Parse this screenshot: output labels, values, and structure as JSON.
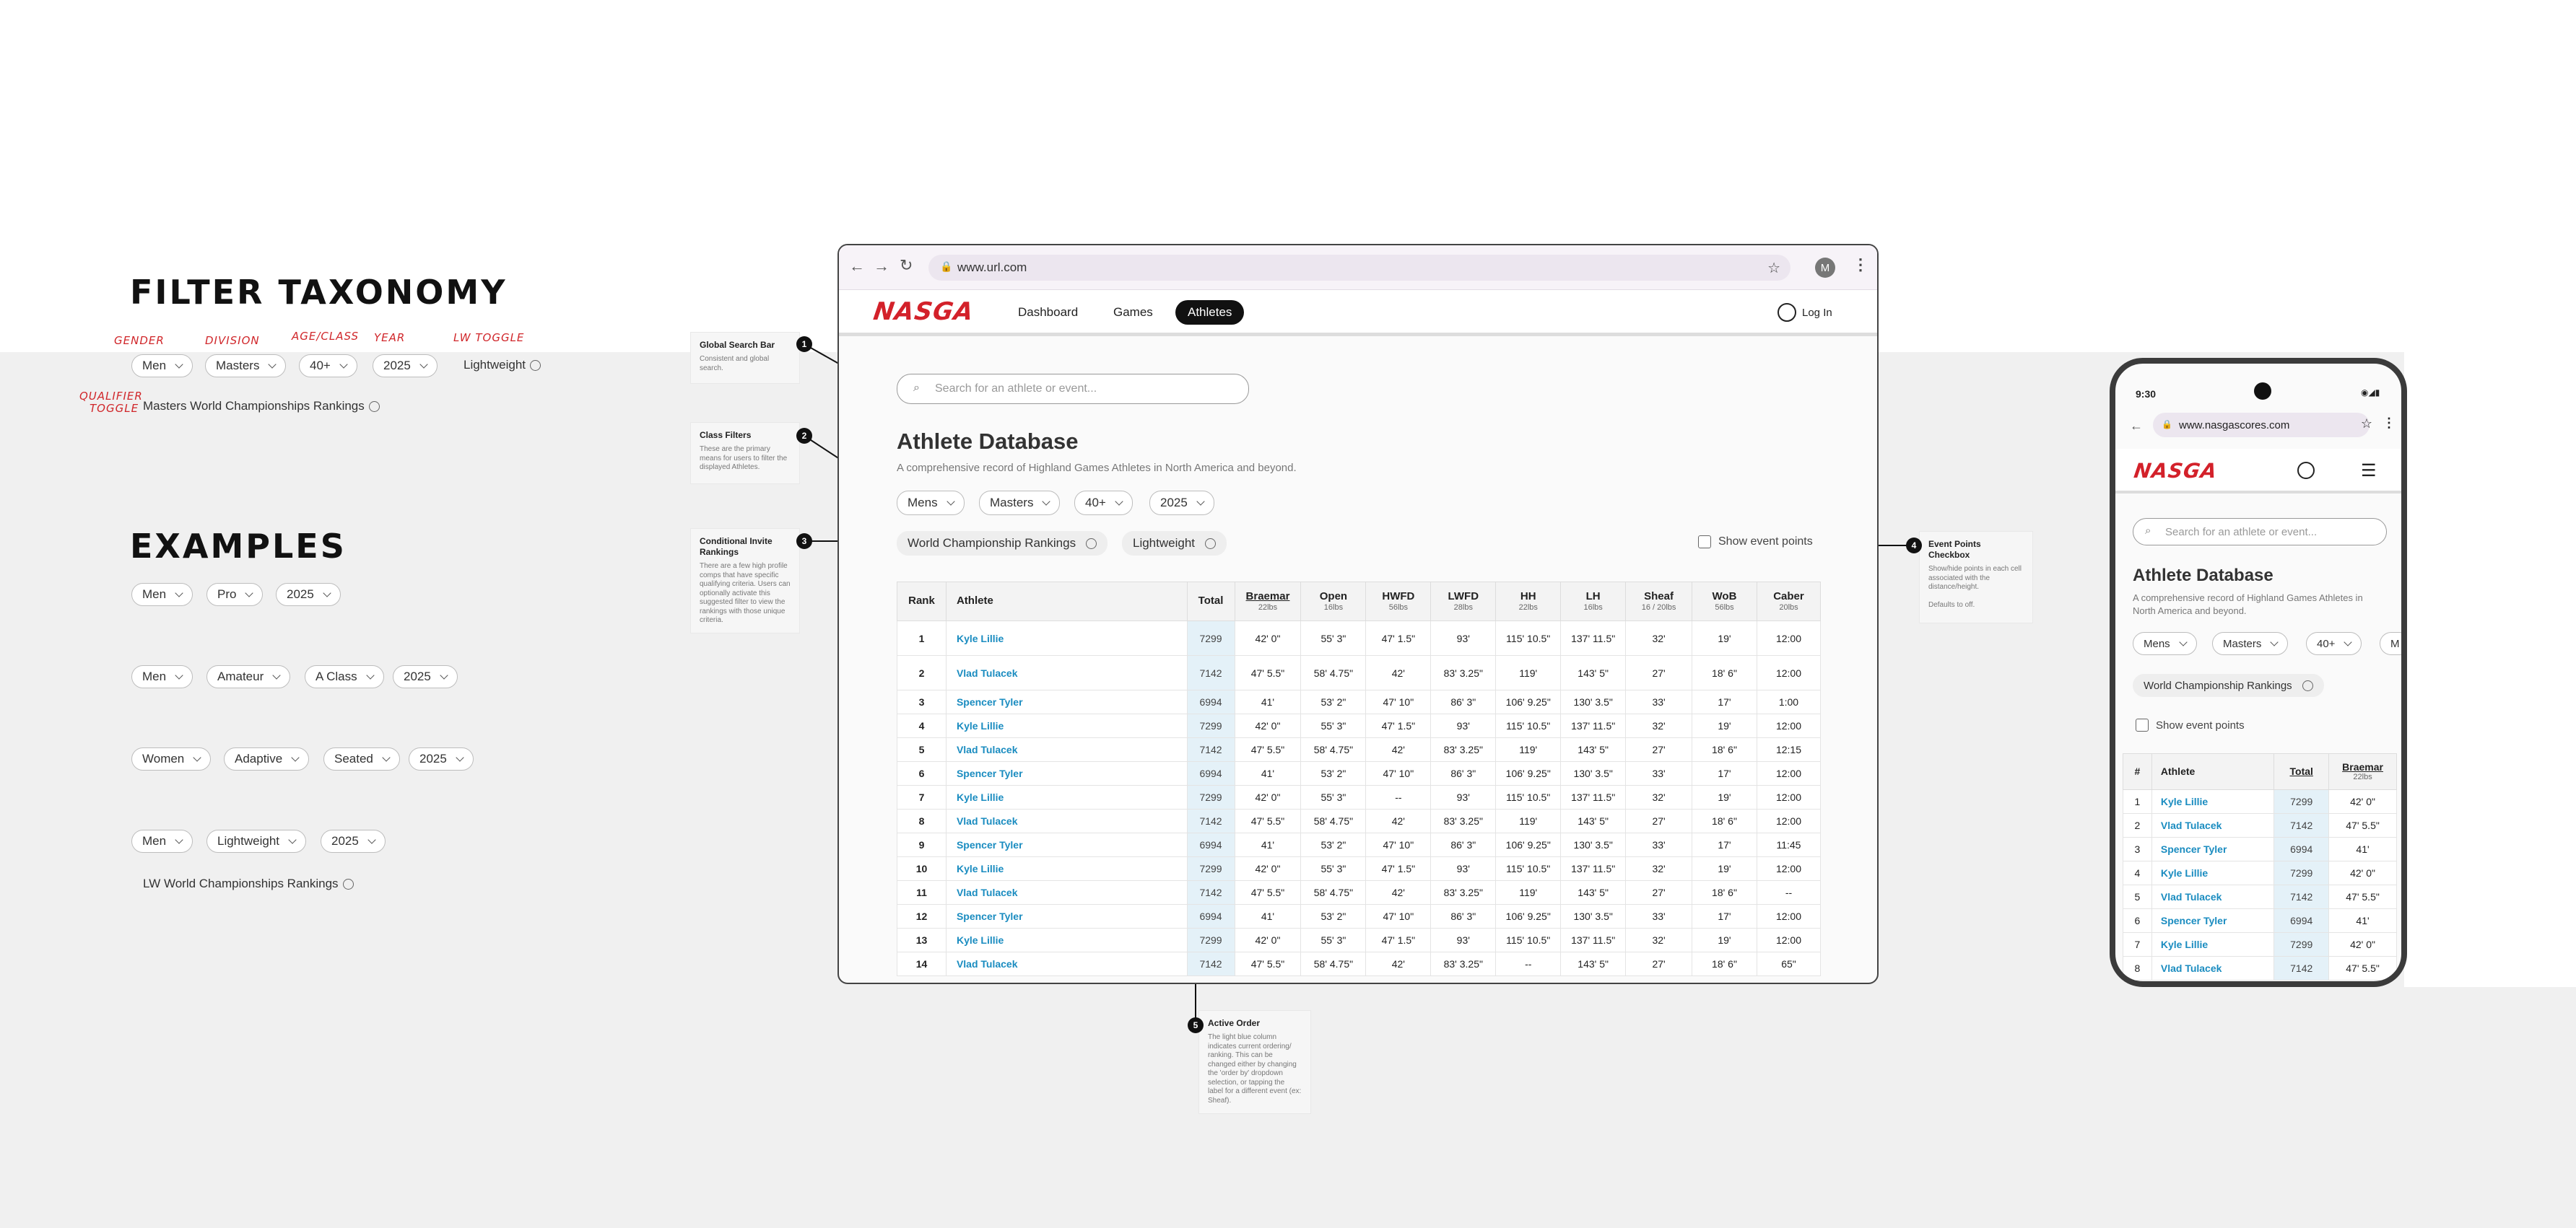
{
  "taxonomy": {
    "title": "FILTER TAXONOMY",
    "hand": {
      "gender": "GENDER",
      "division": "DIVISION",
      "age": "AGE/CLASS",
      "year": "YEAR",
      "lw": "LW TOGGLE",
      "qual1": "QUALIFIER",
      "qual2": "TOGGLE"
    },
    "pills": [
      "Men",
      "Masters",
      "40+",
      "2025"
    ],
    "lw_toggle": "Lightweight",
    "qualifier": "Masters World Championships Rankings"
  },
  "examples": {
    "title": "EXAMPLES",
    "rows": [
      [
        "Men",
        "Pro",
        "2025"
      ],
      [
        "Men",
        "Amateur",
        "A Class",
        "2025"
      ],
      [
        "Women",
        "Adaptive",
        "Seated",
        "2025"
      ],
      [
        "Men",
        "Lightweight",
        "2025"
      ]
    ],
    "lw_rank": "LW World Championships Rankings"
  },
  "notes": {
    "n1": {
      "num": "1",
      "title": "Global Search Bar",
      "body": "Consistent and global search."
    },
    "n2": {
      "num": "2",
      "title": "Class Filters",
      "body": "These are the primary means for users to filter the displayed Athletes."
    },
    "n3": {
      "num": "3",
      "title": "Conditional Invite Rankings",
      "body": "There are a few high profile comps that have specific qualifying criteria. Users can optionally activate this suggested filter to view the rankings with those unique criteria."
    },
    "n4": {
      "num": "4",
      "title": "Event Points Checkbox",
      "body": "Show/hide points in each cell associated with the distance/height.",
      "foot": "Defaults to off."
    },
    "n5": {
      "num": "5",
      "title": "Active Order",
      "body": "The light blue column indicates current ordering/ ranking. This can be changed either by changing the 'order by' dropdown selection, or tapping the label for a different event (ex: Sheaf)."
    }
  },
  "browser": {
    "url": "www.url.com",
    "avatar": "M",
    "logo": "NASGA",
    "nav": [
      "Dashboard",
      "Games",
      "Athletes"
    ],
    "login": "Log In",
    "search_placeholder": "Search for an athlete or event...",
    "title": "Athlete Database",
    "subtitle": "A comprehensive record of Highland Games Athletes in North America and beyond.",
    "filters": [
      "Mens",
      "Masters",
      "40+",
      "2025"
    ],
    "toggle1": "World Championship Rankings",
    "toggle2": "Lightweight",
    "show_points": "Show event points",
    "headers": [
      {
        "t": "Rank",
        "s": ""
      },
      {
        "t": "Athlete",
        "s": ""
      },
      {
        "t": "Total",
        "s": ""
      },
      {
        "t": "Braemar",
        "s": "22lbs"
      },
      {
        "t": "Open",
        "s": "16lbs"
      },
      {
        "t": "HWFD",
        "s": "56lbs"
      },
      {
        "t": "LWFD",
        "s": "28lbs"
      },
      {
        "t": "HH",
        "s": "22lbs"
      },
      {
        "t": "LH",
        "s": "16lbs"
      },
      {
        "t": "Sheaf",
        "s": "16 / 20lbs"
      },
      {
        "t": "WoB",
        "s": "56lbs"
      },
      {
        "t": "Caber",
        "s": "20lbs"
      }
    ],
    "rows": [
      [
        "1",
        "Kyle Lillie",
        "7299",
        "42' 0\"",
        "55' 3\"",
        "47' 1.5\"",
        "93'",
        "115' 10.5\"",
        "137' 11.5\"",
        "32'",
        "19'",
        "12:00"
      ],
      [
        "2",
        "Vlad Tulacek",
        "7142",
        "47' 5.5\"",
        "58' 4.75\"",
        "42'",
        "83' 3.25\"",
        "119'",
        "143' 5\"",
        "27'",
        "18' 6\"",
        "12:00"
      ],
      [
        "3",
        "Spencer Tyler",
        "6994",
        "41'",
        "53' 2\"",
        "47' 10\"",
        "86' 3\"",
        "106' 9.25\"",
        "130' 3.5\"",
        "33'",
        "17'",
        "1:00"
      ],
      [
        "4",
        "Kyle Lillie",
        "7299",
        "42' 0\"",
        "55' 3\"",
        "47' 1.5\"",
        "93'",
        "115' 10.5\"",
        "137' 11.5\"",
        "32'",
        "19'",
        "12:00"
      ],
      [
        "5",
        "Vlad Tulacek",
        "7142",
        "47' 5.5\"",
        "58' 4.75\"",
        "42'",
        "83' 3.25\"",
        "119'",
        "143' 5\"",
        "27'",
        "18' 6\"",
        "12:15"
      ],
      [
        "6",
        "Spencer Tyler",
        "6994",
        "41'",
        "53' 2\"",
        "47' 10\"",
        "86' 3\"",
        "106' 9.25\"",
        "130' 3.5\"",
        "33'",
        "17'",
        "12:00"
      ],
      [
        "7",
        "Kyle Lillie",
        "7299",
        "42' 0\"",
        "55' 3\"",
        "--",
        "93'",
        "115' 10.5\"",
        "137' 11.5\"",
        "32'",
        "19'",
        "12:00"
      ],
      [
        "8",
        "Vlad Tulacek",
        "7142",
        "47' 5.5\"",
        "58' 4.75\"",
        "42'",
        "83' 3.25\"",
        "119'",
        "143' 5\"",
        "27'",
        "18' 6\"",
        "12:00"
      ],
      [
        "9",
        "Spencer Tyler",
        "6994",
        "41'",
        "53' 2\"",
        "47' 10\"",
        "86' 3\"",
        "106' 9.25\"",
        "130' 3.5\"",
        "33'",
        "17'",
        "11:45"
      ],
      [
        "10",
        "Kyle Lillie",
        "7299",
        "42' 0\"",
        "55' 3\"",
        "47' 1.5\"",
        "93'",
        "115' 10.5\"",
        "137' 11.5\"",
        "32'",
        "19'",
        "12:00"
      ],
      [
        "11",
        "Vlad Tulacek",
        "7142",
        "47' 5.5\"",
        "58' 4.75\"",
        "42'",
        "83' 3.25\"",
        "119'",
        "143' 5\"",
        "27'",
        "18' 6\"",
        "--"
      ],
      [
        "12",
        "Spencer Tyler",
        "6994",
        "41'",
        "53' 2\"",
        "47' 10\"",
        "86' 3\"",
        "106' 9.25\"",
        "130' 3.5\"",
        "33'",
        "17'",
        "12:00"
      ],
      [
        "13",
        "Kyle Lillie",
        "7299",
        "42' 0\"",
        "55' 3\"",
        "47' 1.5\"",
        "93'",
        "115' 10.5\"",
        "137' 11.5\"",
        "32'",
        "19'",
        "12:00"
      ],
      [
        "14",
        "Vlad Tulacek",
        "7142",
        "47' 5.5\"",
        "58' 4.75\"",
        "42'",
        "83' 3.25\"",
        "--",
        "143' 5\"",
        "27'",
        "18' 6\"",
        "65\""
      ]
    ]
  },
  "phone": {
    "time": "9:30",
    "url": "www.nasgascores.com",
    "logo": "NASGA",
    "search_placeholder": "Search for an athlete or event...",
    "title": "Athlete Database",
    "subtitle": "A comprehensive record of Highland Games Athletes in North America and beyond.",
    "filters": [
      "Mens",
      "Masters",
      "40+",
      "M"
    ],
    "toggle1": "World Championship Rankings",
    "show_points": "Show event points",
    "headers": [
      {
        "t": "#",
        "s": ""
      },
      {
        "t": "Athlete",
        "s": ""
      },
      {
        "t": "Total",
        "s": ""
      },
      {
        "t": "Braemar",
        "s": "22lbs"
      }
    ],
    "rows": [
      [
        "1",
        "Kyle Lillie",
        "7299",
        "42' 0\""
      ],
      [
        "2",
        "Vlad Tulacek",
        "7142",
        "47' 5.5\""
      ],
      [
        "3",
        "Spencer Tyler",
        "6994",
        "41'"
      ],
      [
        "4",
        "Kyle Lillie",
        "7299",
        "42' 0\""
      ],
      [
        "5",
        "Vlad Tulacek",
        "7142",
        "47' 5.5\""
      ],
      [
        "6",
        "Spencer Tyler",
        "6994",
        "41'"
      ],
      [
        "7",
        "Kyle Lillie",
        "7299",
        "42' 0\""
      ],
      [
        "8",
        "Vlad Tulacek",
        "7142",
        "47' 5.5\""
      ]
    ]
  },
  "colors": {
    "brand": "#d3212a",
    "link": "#1a8cc0",
    "active_column": "#e4f1f8"
  }
}
